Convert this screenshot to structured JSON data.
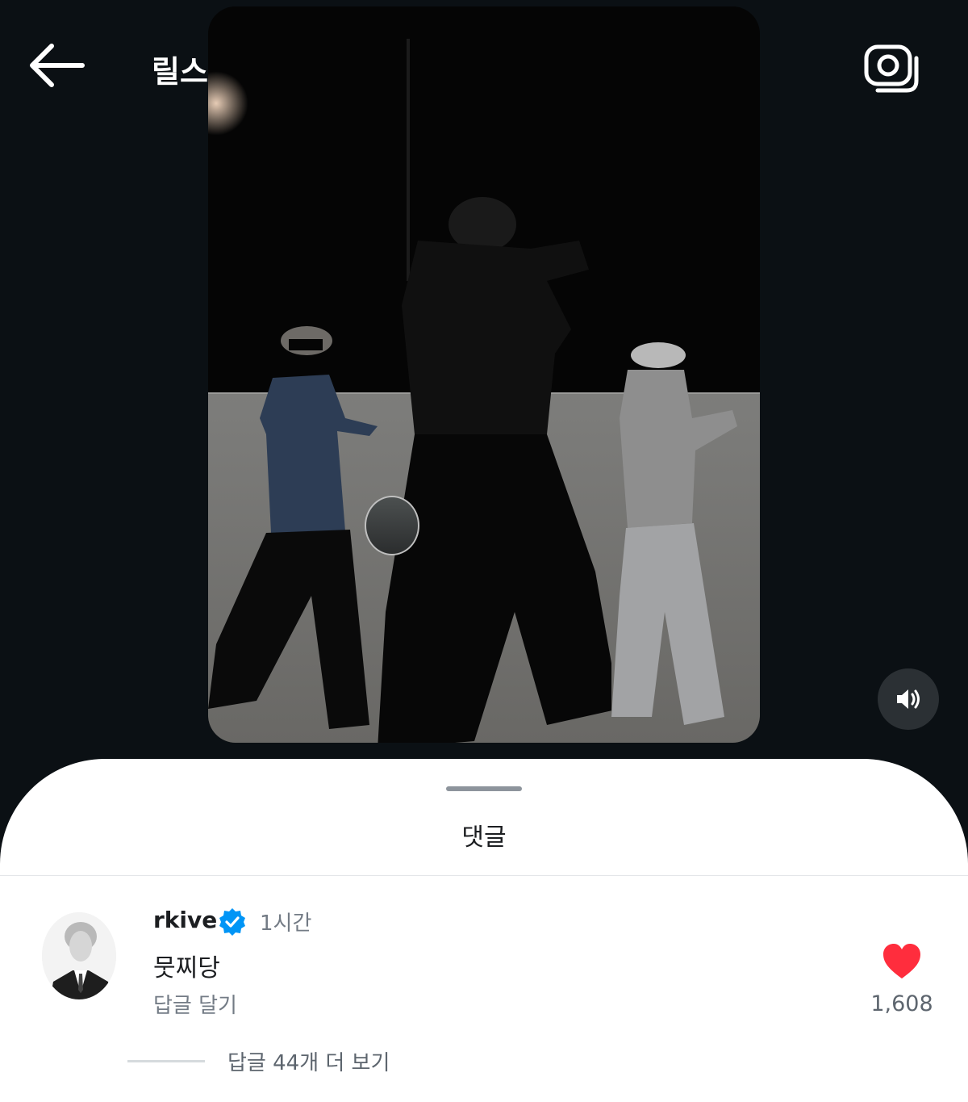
{
  "header": {
    "title": "릴스",
    "back_icon": "arrow-left-icon",
    "camera_icon": "camera-icon"
  },
  "video": {
    "sound_icon": "volume-icon"
  },
  "comments_sheet": {
    "title": "댓글",
    "comment": {
      "username": "rkive",
      "verified_icon": "verified-badge-icon",
      "timestamp": "1시간",
      "text": "뭇찌당",
      "reply_label": "답글 달기",
      "like_icon": "heart-icon",
      "like_count": "1,608",
      "view_replies": "답글 44개 더 보기"
    }
  },
  "colors": {
    "background": "#0b1014",
    "sheet": "#ffffff",
    "like_red": "#ff2d3d",
    "verified_blue": "#0095f6",
    "secondary_text": "#737b85"
  }
}
